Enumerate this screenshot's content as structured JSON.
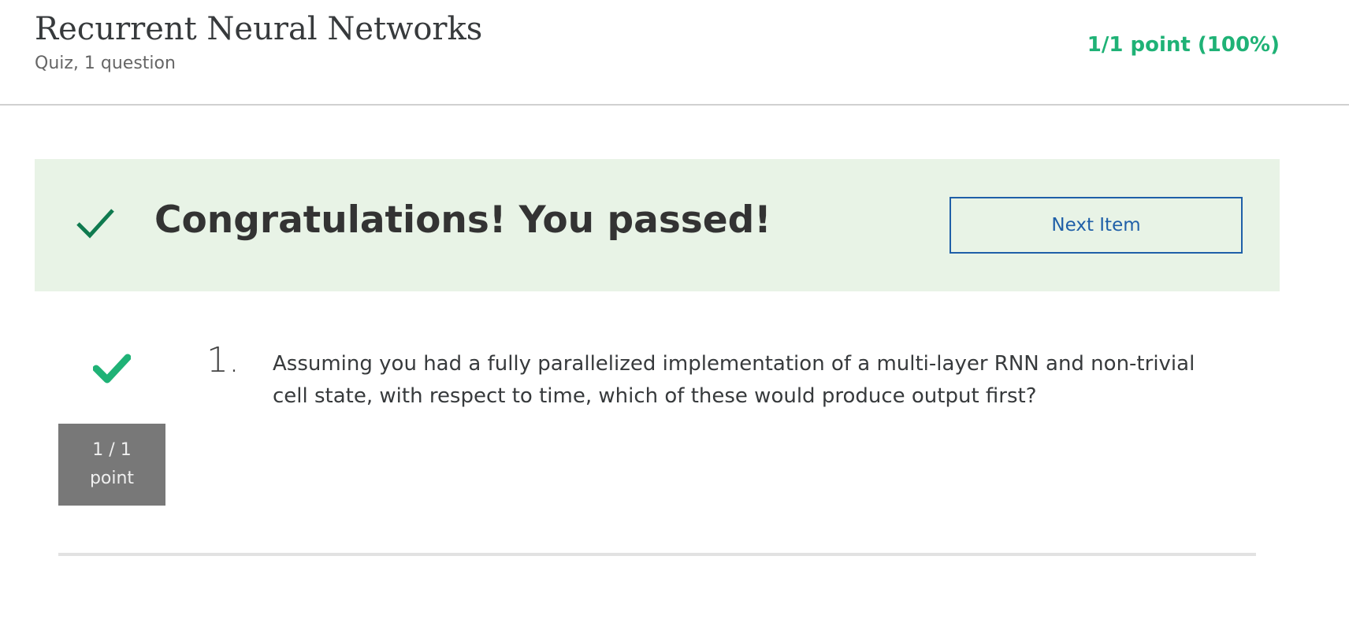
{
  "header": {
    "title": "Recurrent Neural Networks",
    "subtitle": "Quiz, 1 question",
    "score": "1/1 point (100%)"
  },
  "banner": {
    "message": "Congratulations! You passed!",
    "next_label": "Next Item",
    "check_icon": "checkmark-icon"
  },
  "questions": [
    {
      "number": "1.",
      "text": "Assuming you had a fully parallelized implementation of a multi-layer RNN and non-trivial cell state, with respect to time, which of these would produce output first?",
      "points_line1": "1 / 1",
      "points_line2": "point",
      "status_icon": "correct-check-icon"
    }
  ],
  "colors": {
    "score_green": "#1fb276",
    "banner_bg": "#e8f3e6",
    "banner_check": "#0f7a4f",
    "button_blue": "#1f5fa8",
    "points_bg": "#787878"
  }
}
